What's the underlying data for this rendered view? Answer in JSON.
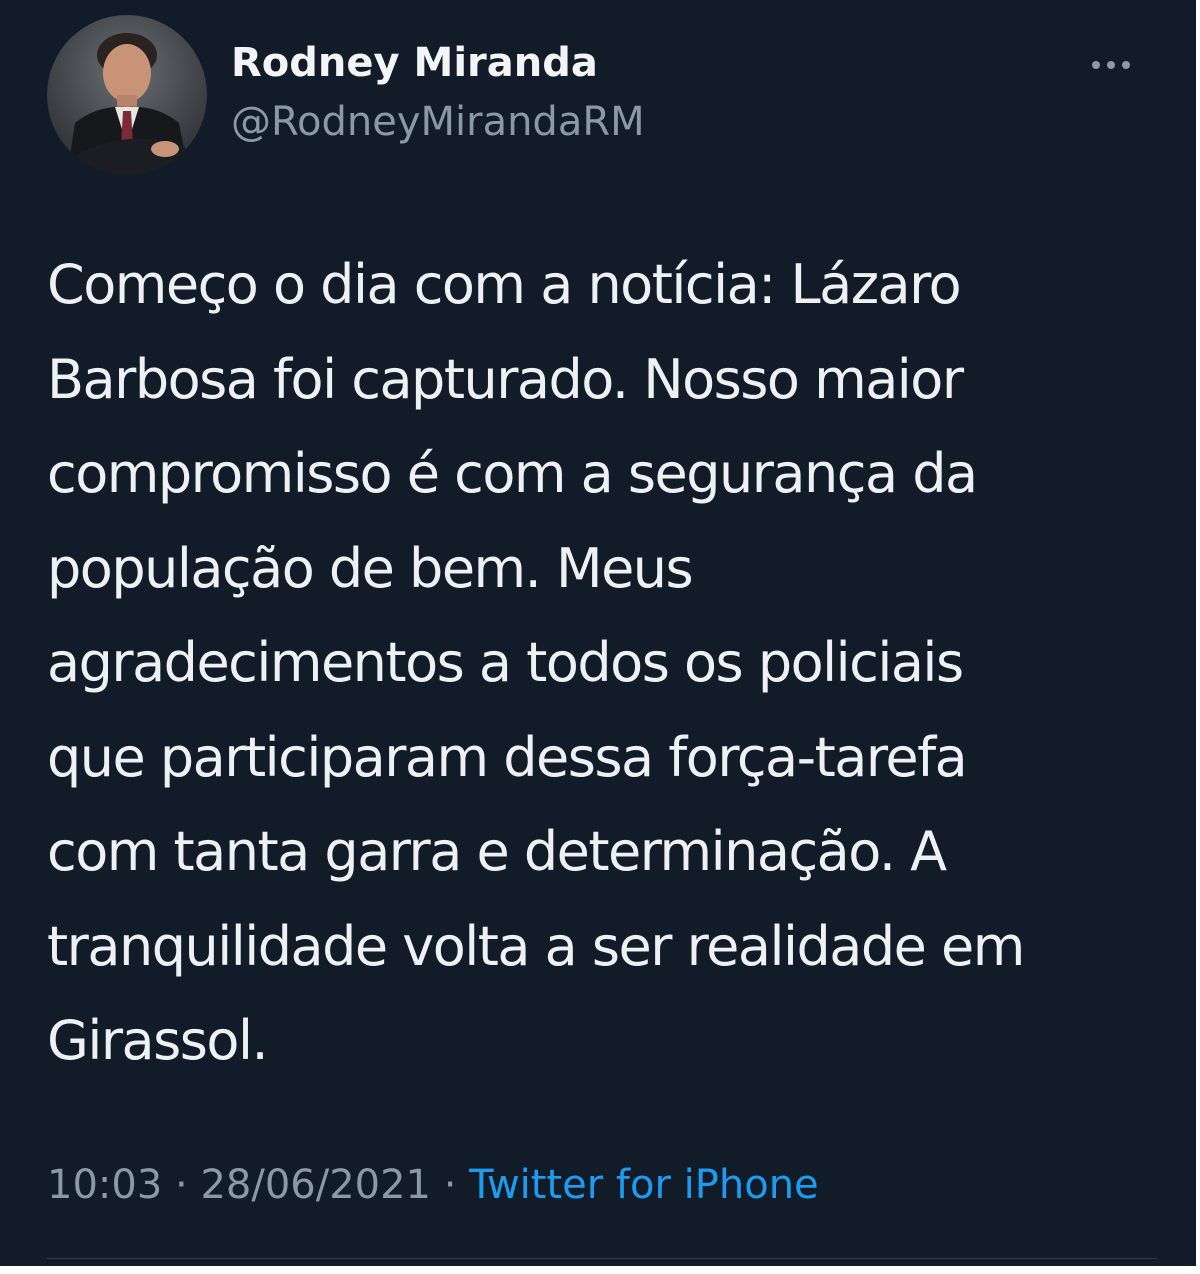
{
  "tweet": {
    "author": {
      "name": "Rodney Miranda",
      "handle": "@RodneyMirandaRM",
      "avatar_icon": "profile-photo"
    },
    "more_icon": "more-options-icon",
    "text": "Começo o dia com a notícia: Lázaro\nBarbosa foi capturado. Nosso maior\ncompromisso é com a segurança da\npopulação de bem. Meus\nagradecimentos a todos os policiais\nque participaram dessa força-tarefa\ncom tanta garra e determinação. A\ntranquilidade volta a ser realidade em\nGirassol.",
    "time": "10:03",
    "date": "28/06/2021",
    "separator": "·",
    "source": "Twitter for iPhone"
  },
  "colors": {
    "background": "#121c28",
    "text": "#eef1f4",
    "secondary": "#8b98a5",
    "link": "#1d9bf0"
  }
}
